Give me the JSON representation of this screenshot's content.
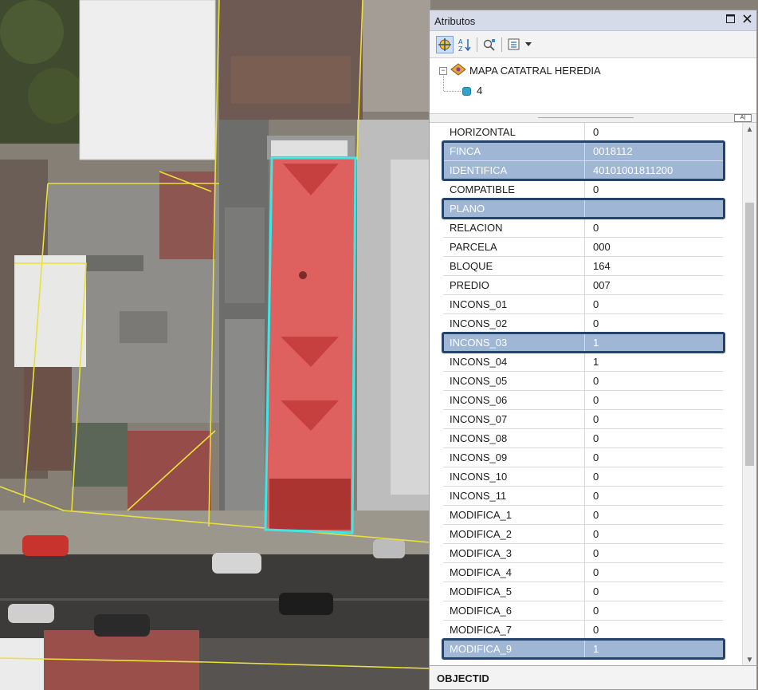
{
  "panel": {
    "title": "Atributos",
    "maximize_icon": "maximize-icon",
    "close_icon": "close-icon",
    "toolbar": {
      "buttons": [
        "identify-icon",
        "sort-az-icon",
        "zoom-to-icon",
        "options-menu-icon",
        "dropdown-arrow-icon"
      ]
    },
    "tree": {
      "layer_name": "MAPA CATATRAL HEREDIA",
      "feature_id": "4",
      "collapse_symbol": "−"
    },
    "footer_label": "OBJECTID"
  },
  "attributes": [
    {
      "field": "HORIZONTAL",
      "value": "0",
      "highlight": false
    },
    {
      "field": "FINCA",
      "value": "0018112",
      "highlight": true
    },
    {
      "field": "IDENTIFICA",
      "value": "40101001811200",
      "highlight": true
    },
    {
      "field": "COMPATIBLE",
      "value": "0",
      "highlight": false
    },
    {
      "field": "PLANO",
      "value": "",
      "highlight": true
    },
    {
      "field": "RELACION",
      "value": "0",
      "highlight": false
    },
    {
      "field": "PARCELA",
      "value": "000",
      "highlight": false
    },
    {
      "field": "BLOQUE",
      "value": "164",
      "highlight": false
    },
    {
      "field": "PREDIO",
      "value": "007",
      "highlight": false
    },
    {
      "field": "INCONS_01",
      "value": "0",
      "highlight": false
    },
    {
      "field": "INCONS_02",
      "value": "0",
      "highlight": false
    },
    {
      "field": "INCONS_03",
      "value": "1",
      "highlight": true
    },
    {
      "field": "INCONS_04",
      "value": "1",
      "highlight": false
    },
    {
      "field": "INCONS_05",
      "value": "0",
      "highlight": false
    },
    {
      "field": "INCONS_06",
      "value": "0",
      "highlight": false
    },
    {
      "field": "INCONS_07",
      "value": "0",
      "highlight": false
    },
    {
      "field": "INCONS_08",
      "value": "0",
      "highlight": false
    },
    {
      "field": "INCONS_09",
      "value": "0",
      "highlight": false
    },
    {
      "field": "INCONS_10",
      "value": "0",
      "highlight": false
    },
    {
      "field": "INCONS_11",
      "value": "0",
      "highlight": false
    },
    {
      "field": "MODIFICA_1",
      "value": "0",
      "highlight": false
    },
    {
      "field": "MODIFICA_2",
      "value": "0",
      "highlight": false
    },
    {
      "field": "MODIFICA_3",
      "value": "0",
      "highlight": false
    },
    {
      "field": "MODIFICA_4",
      "value": "0",
      "highlight": false
    },
    {
      "field": "MODIFICA_5",
      "value": "0",
      "highlight": false
    },
    {
      "field": "MODIFICA_6",
      "value": "0",
      "highlight": false
    },
    {
      "field": "MODIFICA_7",
      "value": "0",
      "highlight": false
    },
    {
      "field": "MODIFICA_9",
      "value": "1",
      "highlight": true
    }
  ],
  "colors": {
    "selection_fill": "#f25a5a",
    "selection_outline": "#3fe6e6",
    "parcel_lines": "#e9e13a",
    "highlight_row": "#9fb6d4",
    "highlight_border": "#26446b"
  }
}
